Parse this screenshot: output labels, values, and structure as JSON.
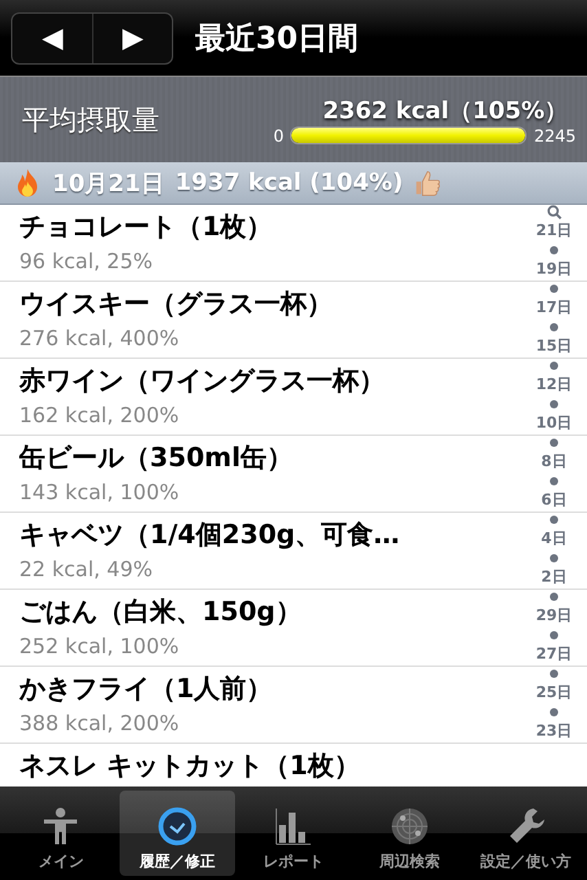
{
  "nav": {
    "title": "最近30日間",
    "prev": "◀",
    "next": "▶"
  },
  "summary": {
    "label": "平均摂取量",
    "value": "2362 kcal（105%）",
    "min": "0",
    "max": "2245",
    "level": 1
  },
  "day_header": {
    "date": "10月21日",
    "total": "1937 kcal (104%)"
  },
  "items": [
    {
      "name": "チョコレート（1枚）",
      "detail": "96 kcal, 25%"
    },
    {
      "name": "ウイスキー（グラス一杯）",
      "detail": "276 kcal, 400%"
    },
    {
      "name": "赤ワイン（ワイングラス一杯）",
      "detail": "162 kcal, 200%"
    },
    {
      "name": "缶ビール（350ml缶）",
      "detail": "143 kcal, 100%"
    },
    {
      "name": "キャベツ（1/4個230g、可食…",
      "detail": "22 kcal, 49%"
    },
    {
      "name": "ごはん（白米、150g）",
      "detail": "252 kcal, 100%"
    },
    {
      "name": "かきフライ（1人前）",
      "detail": "388 kcal, 200%"
    },
    {
      "name": "ネスレ キットカット（1枚）"
    }
  ],
  "index": [
    "21日",
    "19日",
    "17日",
    "15日",
    "12日",
    "10日",
    "8日",
    "6日",
    "4日",
    "2日",
    "29日",
    "27日",
    "25日",
    "23日"
  ],
  "tabs": [
    {
      "label": "メイン",
      "selected": false
    },
    {
      "label": "履歴／修正",
      "selected": true
    },
    {
      "label": "レポート",
      "selected": false
    },
    {
      "label": "周辺検索",
      "selected": false
    },
    {
      "label": "設定／使い方",
      "selected": false
    }
  ]
}
